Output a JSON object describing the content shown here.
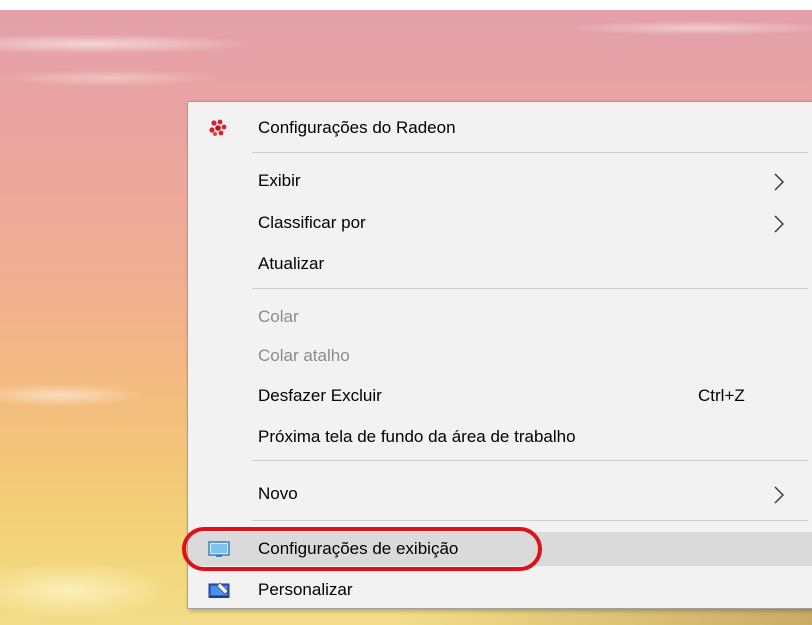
{
  "context_menu": {
    "items": [
      {
        "label": "Configurações do Radeon",
        "icon": "radeon-icon",
        "disabled": false
      },
      {
        "label": "Exibir",
        "has_submenu": true,
        "disabled": false
      },
      {
        "label": "Classificar por",
        "has_submenu": true,
        "disabled": false
      },
      {
        "label": "Atualizar",
        "disabled": false
      },
      {
        "label": "Colar",
        "disabled": true
      },
      {
        "label": "Colar atalho",
        "disabled": true
      },
      {
        "label": "Desfazer Excluir",
        "shortcut": "Ctrl+Z",
        "disabled": false
      },
      {
        "label": "Próxima tela de fundo da área de trabalho",
        "disabled": false
      },
      {
        "label": "Novo",
        "has_submenu": true,
        "disabled": false
      },
      {
        "label": "Configurações de exibição",
        "icon": "display-settings-icon",
        "highlighted": true,
        "disabled": false
      },
      {
        "label": "Personalizar",
        "icon": "personalize-icon",
        "disabled": false
      }
    ]
  },
  "colors": {
    "menu_background": "#f2f2f2",
    "highlight_background": "#dadada",
    "disabled_text": "#8c8c8c",
    "annotation_circle": "#e0101a",
    "radeon_red": "#d9202a"
  }
}
